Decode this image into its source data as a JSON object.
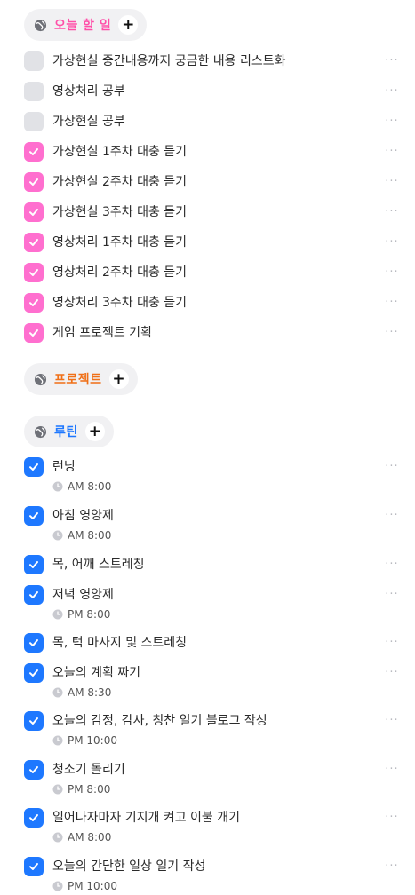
{
  "sections": {
    "today": {
      "title": "오늘 할 일",
      "color": "#ff4fa8"
    },
    "project": {
      "title": "프로젝트",
      "color": "#f07018"
    },
    "routine": {
      "title": "루틴",
      "color": "#1e78ff"
    }
  },
  "today_tasks": [
    {
      "label": "가상현실 중간내용까지 궁금한 내용 리스트화",
      "done": false
    },
    {
      "label": "영상처리 공부",
      "done": false
    },
    {
      "label": "가상현실 공부",
      "done": false
    },
    {
      "label": "가상현실 1주차 대충 듣기",
      "done": true
    },
    {
      "label": "가상현실 2주차 대충 듣기",
      "done": true
    },
    {
      "label": "가상현실 3주차 대충 듣기",
      "done": true
    },
    {
      "label": "영상처리 1주차 대충 듣기",
      "done": true
    },
    {
      "label": "영상처리 2주차 대충 듣기",
      "done": true
    },
    {
      "label": "영상처리 3주차 대충 듣기",
      "done": true
    },
    {
      "label": "게임 프로젝트 기획",
      "done": true
    }
  ],
  "routine_tasks": [
    {
      "label": "런닝",
      "time": "AM 8:00",
      "done": true
    },
    {
      "label": "아침 영양제",
      "time": "AM 8:00",
      "done": true
    },
    {
      "label": "목, 어깨 스트레칭",
      "time": "",
      "done": true
    },
    {
      "label": "저녁 영양제",
      "time": "PM 8:00",
      "done": true
    },
    {
      "label": "목, 턱 마사지 및 스트레칭",
      "time": "",
      "done": true
    },
    {
      "label": "오늘의 계획 짜기",
      "time": "AM 8:30",
      "done": true
    },
    {
      "label": "오늘의 감정, 감사, 칭찬 일기 블로그 작성",
      "time": "PM 10:00",
      "done": true
    },
    {
      "label": "청소기 돌리기",
      "time": "PM 8:00",
      "done": true
    },
    {
      "label": "일어나자마자 기지개 켜고 이불 개기",
      "time": "AM 8:00",
      "done": true
    },
    {
      "label": "오늘의 간단한 일상 일기 작성",
      "time": "PM 10:00",
      "done": true
    }
  ],
  "icons": {
    "more": "more-horizontal-icon",
    "globe": "globe-icon",
    "plus": "plus-icon",
    "check": "check-icon",
    "clock": "clock-icon"
  },
  "plus_symbol": "+",
  "more_symbol": "···"
}
